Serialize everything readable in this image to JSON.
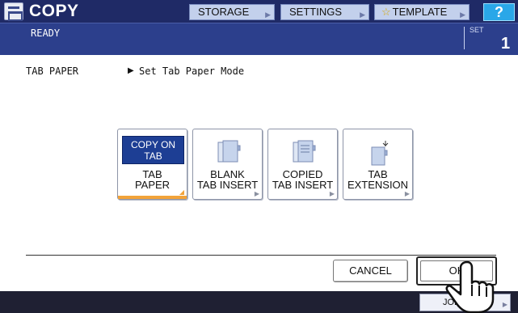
{
  "header": {
    "title": "COPY",
    "storage_label": "STORAGE",
    "settings_label": "SETTINGS",
    "template_label": "TEMPLATE",
    "help_label": "?"
  },
  "status": {
    "text": "READY",
    "set_label": "SET",
    "set_count": "1"
  },
  "mode": {
    "label": "TAB PAPER",
    "description": "Set Tab Paper Mode"
  },
  "mode_buttons": {
    "copy_on_tab": {
      "badge_line1": "COPY ON",
      "badge_line2": "TAB",
      "line1": "TAB",
      "line2": "PAPER",
      "selected": true
    },
    "blank_tab_insert": {
      "line1": "BLANK",
      "line2": "TAB INSERT"
    },
    "copied_tab_insert": {
      "line1": "COPIED",
      "line2": "TAB INSERT"
    },
    "tab_extension": {
      "line1": "TAB",
      "line2": "EXTENSION"
    }
  },
  "actions": {
    "cancel_label": "CANCEL",
    "ok_label": "OK",
    "job_status_label": "JOB S"
  },
  "colors": {
    "topbar": "#1f2a66",
    "statusbar": "#2c3f8c",
    "accent_orange": "#f2a33a",
    "badge_blue": "#1d3e94"
  },
  "icons": {
    "app": "copy-icon",
    "template": "star-icon",
    "cursor": "hand-pointer-icon"
  }
}
